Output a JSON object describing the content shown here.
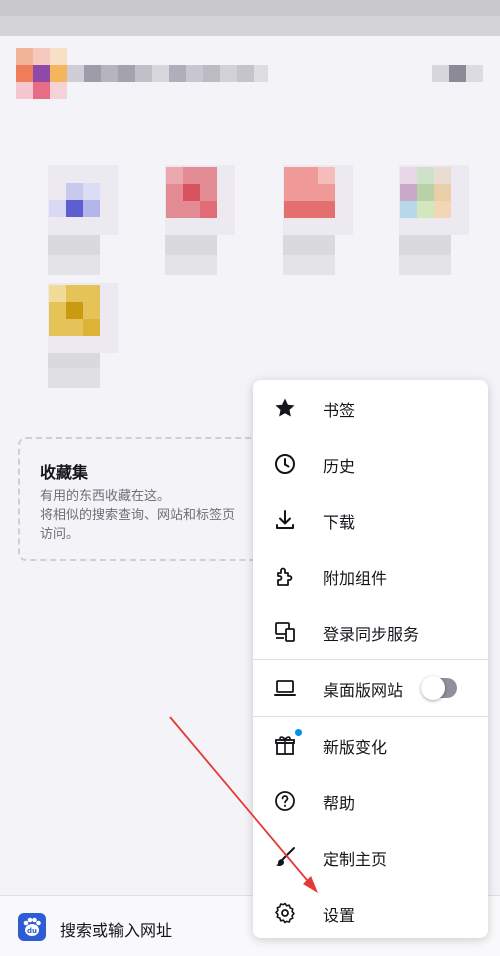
{
  "collection": {
    "title": "收藏集",
    "desc_line1": "有用的东西收藏在这。",
    "desc_line2": "将相似的搜索查询、网站和标签页",
    "desc_line3": "访问。"
  },
  "address_bar": {
    "placeholder": "搜索或输入网址",
    "engine_icon": "baidu-icon"
  },
  "menu": {
    "items": [
      {
        "label": "书签",
        "icon": "star-icon"
      },
      {
        "label": "历史",
        "icon": "clock-icon"
      },
      {
        "label": "下载",
        "icon": "download-icon"
      },
      {
        "label": "附加组件",
        "icon": "puzzle-icon"
      },
      {
        "label": "登录同步服务",
        "icon": "sync-devices-icon"
      },
      {
        "label": "桌面版网站",
        "icon": "laptop-icon",
        "toggle_on": false
      },
      {
        "label": "新版变化",
        "icon": "gift-icon",
        "badge_color": "#0090ed"
      },
      {
        "label": "帮助",
        "icon": "help-icon"
      },
      {
        "label": "定制主页",
        "icon": "brush-icon"
      },
      {
        "label": "设置",
        "icon": "gear-icon"
      }
    ]
  },
  "colors": {
    "accent": "#0090ed",
    "annotation_arrow": "#e53935"
  }
}
